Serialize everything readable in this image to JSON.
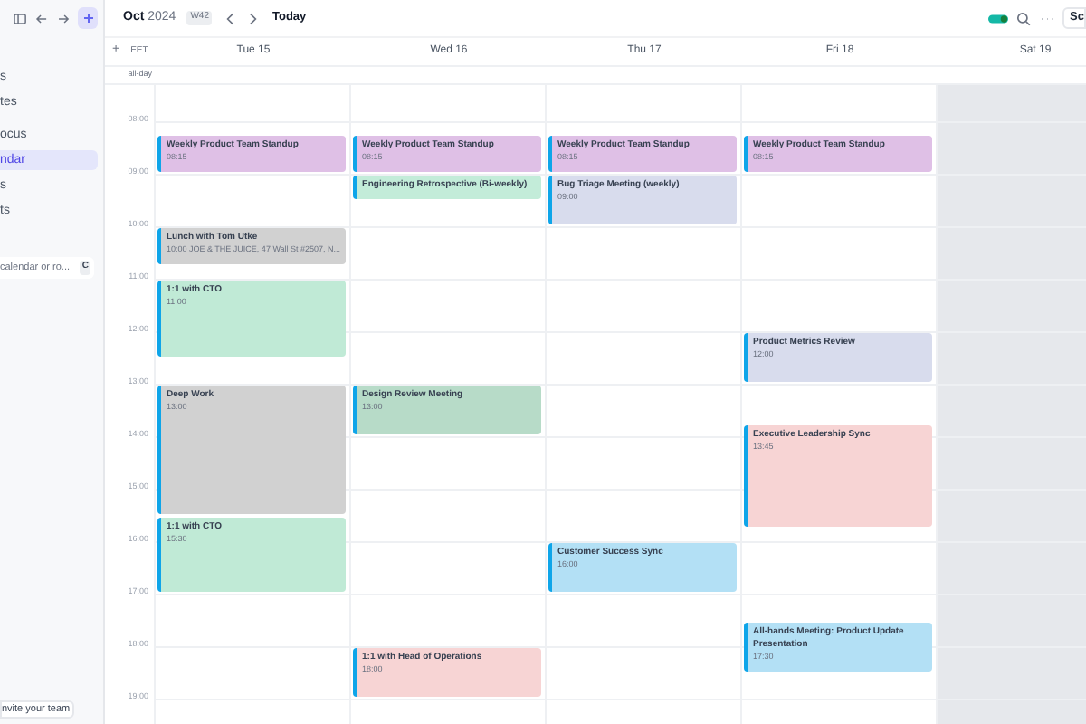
{
  "sidebar": {
    "items": [
      {
        "label": "s",
        "selected": false
      },
      {
        "label": "tes",
        "selected": false
      },
      {
        "label": "ocus",
        "selected": false
      },
      {
        "label": "ndar",
        "selected": true
      },
      {
        "label": "s",
        "selected": false
      },
      {
        "label": "ts",
        "selected": false
      }
    ],
    "search": {
      "placeholder": "calendar or ro...",
      "shortcut": "C"
    },
    "invite_button": "nvite your team"
  },
  "header": {
    "month": "Oct",
    "year": "2024",
    "week": "W42",
    "today_button": "Today",
    "right_button": "Sc"
  },
  "calendar": {
    "add_label": "+",
    "timezone": "EET",
    "all_day_label": "all-day",
    "hours": [
      "08:00",
      "09:00",
      "10:00",
      "11:00",
      "12:00",
      "13:00",
      "14:00",
      "15:00",
      "16:00",
      "17:00",
      "18:00",
      "19:00"
    ],
    "days": [
      {
        "label": "Tue 15",
        "weekend": false,
        "events": [
          {
            "title": "Weekly Product Team Standup",
            "time": "08:15",
            "color": "#dfc0e6"
          },
          {
            "title": "Lunch with Tom Utke",
            "time": "10:00 JOE & THE JUICE, 47 Wall St #2507, N...",
            "color": "#d1d1d1"
          },
          {
            "title": "1:1 with CTO",
            "time": "11:00",
            "color": "#c0ead6"
          },
          {
            "title": "Deep Work",
            "time": "13:00",
            "color": "#d1d1d1"
          },
          {
            "title": "1:1 with CTO",
            "time": "15:30",
            "color": "#c0ead6"
          }
        ]
      },
      {
        "label": "Wed 16",
        "weekend": false,
        "events": [
          {
            "title": "Weekly Product Team Standup",
            "time": "08:15",
            "color": "#dfc0e6"
          },
          {
            "title": "Engineering Retrospective (Bi-weekly)",
            "color": "#c3ecd9"
          },
          {
            "title": "Design Review Meeting",
            "time": "13:00",
            "color": "#b7dbc8"
          },
          {
            "title": "1:1 with Head of Operations",
            "time": "18:00",
            "color": "#f7d4d4"
          }
        ]
      },
      {
        "label": "Thu 17",
        "weekend": false,
        "events": [
          {
            "title": "Weekly Product Team Standup",
            "time": "08:15",
            "color": "#dfc0e6"
          },
          {
            "title": "Bug Triage Meeting (weekly)",
            "time": "09:00",
            "color": "#d8dced"
          },
          {
            "title": "Customer Success Sync",
            "time": "16:00",
            "color": "#b3e0f5"
          }
        ]
      },
      {
        "label": "Fri 18",
        "weekend": false,
        "events": [
          {
            "title": "Weekly Product Team Standup",
            "time": "08:15",
            "color": "#dfc0e6"
          },
          {
            "title": "Product Metrics Review",
            "time": "12:00",
            "color": "#d8dced"
          },
          {
            "title": "Executive Leadership Sync",
            "time": "13:45",
            "color": "#f7d4d4"
          },
          {
            "title": "All-hands Meeting: Product Update Presentation",
            "time": "17:30",
            "color": "#b3e0f5"
          }
        ]
      },
      {
        "label": "Sat 19",
        "weekend": true
      }
    ]
  }
}
